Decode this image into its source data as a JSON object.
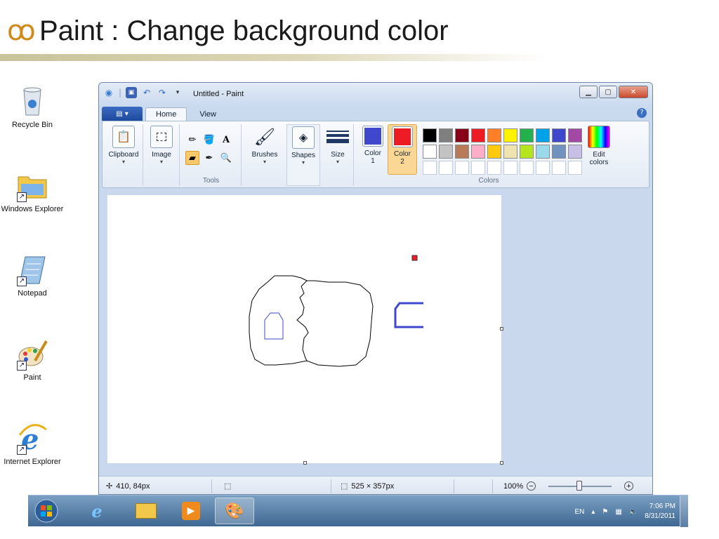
{
  "slide": {
    "title_icon": "ꝏ",
    "title": "Paint : Change background color"
  },
  "desktop": {
    "icons": [
      {
        "label": "Recycle Bin",
        "icon": "recycle-bin-icon"
      },
      {
        "label": "Windows Explorer",
        "icon": "folder-icon"
      },
      {
        "label": "Notepad",
        "icon": "notepad-icon"
      },
      {
        "label": "Paint",
        "icon": "paint-palette-icon"
      },
      {
        "label": "Internet Explorer",
        "icon": "internet-explorer-icon"
      }
    ]
  },
  "window": {
    "title": "Untitled - Paint",
    "tabs": [
      "Home",
      "View"
    ],
    "ribbon": {
      "clipboard": "Clipboard",
      "image": "Image",
      "tools_label": "Tools",
      "brushes": "Brushes",
      "shapes": "Shapes",
      "size": "Size",
      "color1": "Color\n1",
      "color2": "Color\n2",
      "colors_label": "Colors",
      "edit_colors": "Edit colors",
      "color1_value": "#3f48cc",
      "color2_value": "#ed1c24",
      "palette_row1": [
        "#000000",
        "#7f7f7f",
        "#880015",
        "#ed1c24",
        "#ff7f27",
        "#fff200",
        "#22b14c",
        "#00a2e8",
        "#3f48cc",
        "#a349a4"
      ],
      "palette_row2": [
        "#ffffff",
        "#c3c3c3",
        "#b97a57",
        "#ffaec9",
        "#ffc90e",
        "#efe4b0",
        "#b5e61d",
        "#99d9ea",
        "#7092be",
        "#c8bfe7"
      ]
    },
    "status": {
      "cursor_pos": "410, 84px",
      "selection_size": "",
      "canvas_size": "525 × 357px",
      "zoom": "100%"
    }
  },
  "taskbar": {
    "lang": "EN",
    "time": "7:06 PM",
    "date": "8/31/2011"
  }
}
